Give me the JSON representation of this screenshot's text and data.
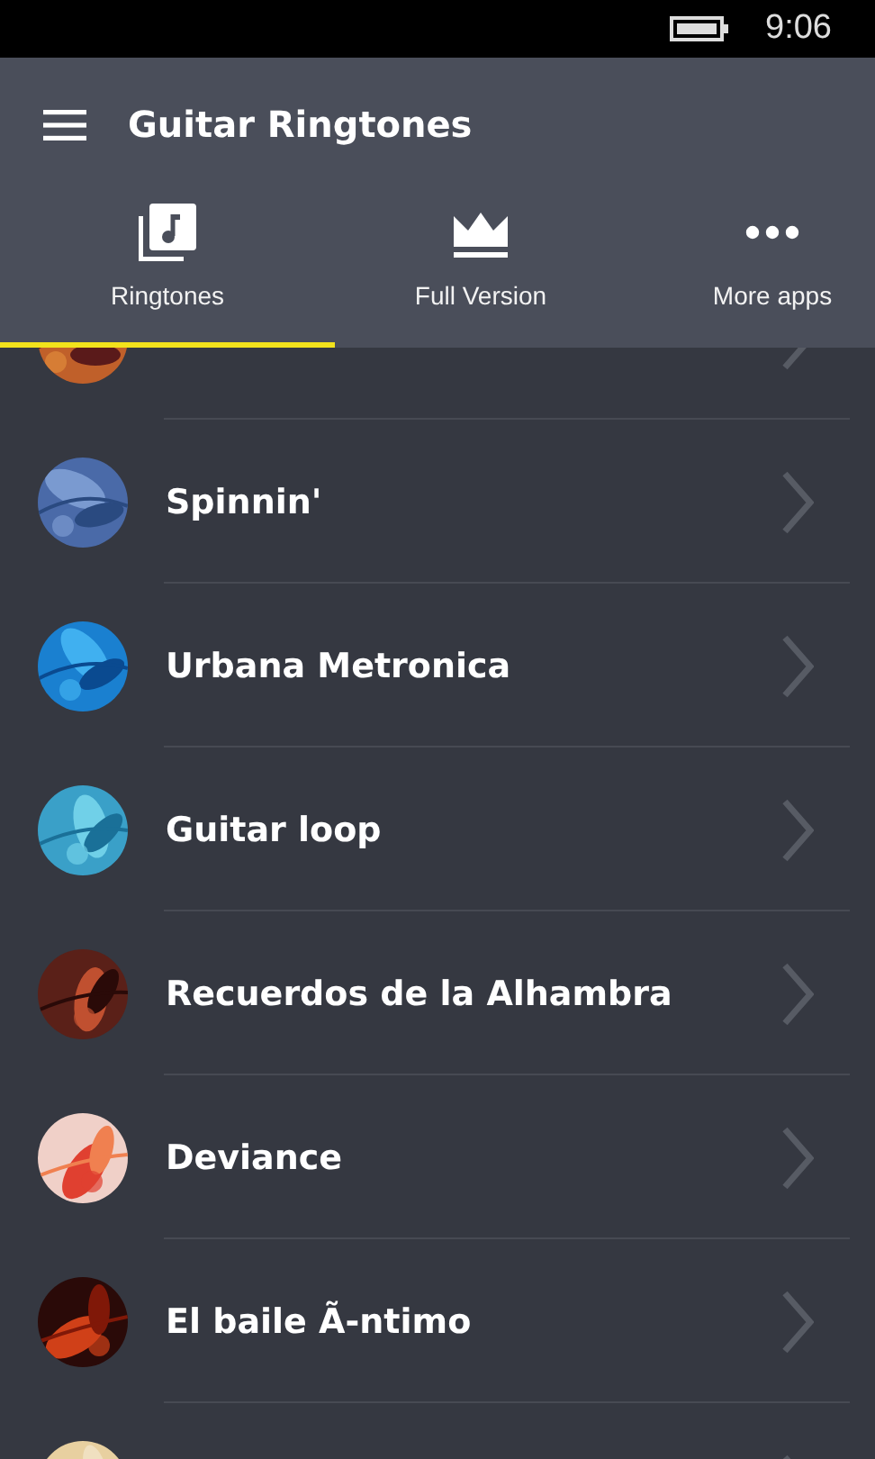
{
  "status_bar": {
    "time": "9:06"
  },
  "header": {
    "title": "Guitar Ringtones"
  },
  "tabs": [
    {
      "label": "Ringtones",
      "kind": "music",
      "selected": true
    },
    {
      "label": "Full Version",
      "kind": "crown",
      "selected": false
    },
    {
      "label": "More apps",
      "kind": "more",
      "selected": false
    }
  ],
  "ringtones": [
    {
      "thumbnail": {
        "kind": "picture"
      }
    },
    {
      "title": "Spinnin'",
      "thumbnail": {
        "kind": "picture"
      }
    },
    {
      "title": "Urbana Metronica",
      "thumbnail": {
        "kind": "picture"
      }
    },
    {
      "title": "Guitar loop",
      "thumbnail": {
        "kind": "picture"
      }
    },
    {
      "title": "Recuerdos de la Alhambra",
      "thumbnail": {
        "kind": "picture"
      }
    },
    {
      "title": "Deviance",
      "thumbnail": {
        "kind": "picture"
      }
    },
    {
      "title": "El baile Ã-ntimo",
      "thumbnail": {
        "kind": "picture"
      }
    },
    {
      "thumbnail": {
        "kind": "picture"
      }
    }
  ]
}
